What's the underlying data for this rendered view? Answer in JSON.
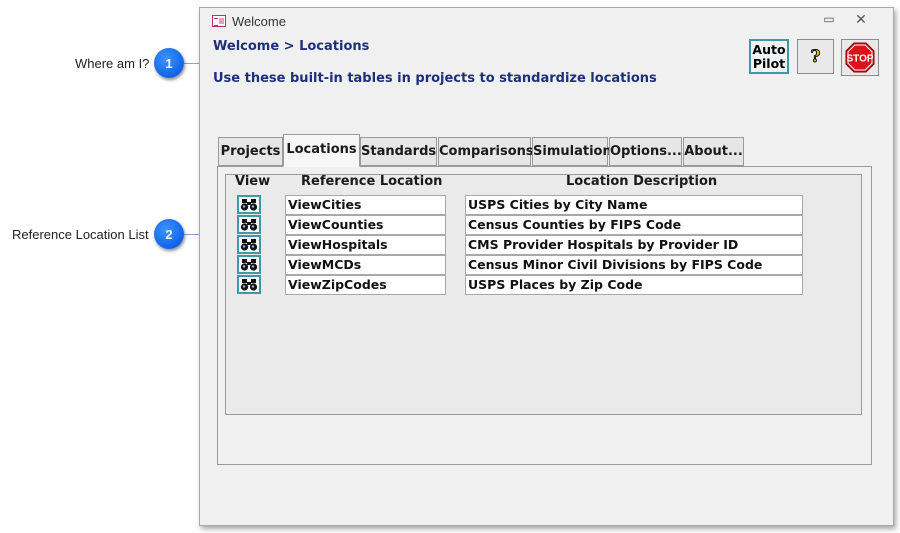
{
  "callouts": [
    {
      "number": "1",
      "label": "Where am I?"
    },
    {
      "number": "2",
      "label": "Reference Location List"
    }
  ],
  "window": {
    "title": "Welcome"
  },
  "header": {
    "breadcrumb": "Welcome > Locations",
    "subtitle": "Use these built-in tables in projects to standardize locations"
  },
  "buttons": {
    "autopilot_line1": "Auto",
    "autopilot_line2": "Pilot",
    "help": "?",
    "stop": "STOP"
  },
  "tabs": [
    {
      "label": "Projects",
      "active": false
    },
    {
      "label": "Locations",
      "active": true
    },
    {
      "label": "Standards",
      "active": false
    },
    {
      "label": "Comparisons",
      "active": false
    },
    {
      "label": "Simulation",
      "active": false
    },
    {
      "label": "Options...",
      "active": false
    },
    {
      "label": "About...",
      "active": false
    }
  ],
  "table": {
    "columns": [
      "View",
      "Reference Location",
      "Location Description"
    ],
    "rows": [
      {
        "location": "ViewCities",
        "description": "USPS Cities by City Name"
      },
      {
        "location": "ViewCounties",
        "description": "Census Counties by FIPS Code"
      },
      {
        "location": "ViewHospitals",
        "description": "CMS Provider Hospitals by Provider ID"
      },
      {
        "location": "ViewMCDs",
        "description": "Census Minor Civil Divisions by FIPS Code"
      },
      {
        "location": "ViewZipCodes",
        "description": "USPS Places by Zip Code"
      }
    ]
  },
  "colors": {
    "accent": "#1f2f7a",
    "badge": "#1063e6",
    "stop": "#d9121b",
    "button_border": "#3c9aa3"
  },
  "icons": {
    "view_button": "binoculars-icon",
    "window": "form-icon",
    "stop": "stop-sign-icon"
  }
}
